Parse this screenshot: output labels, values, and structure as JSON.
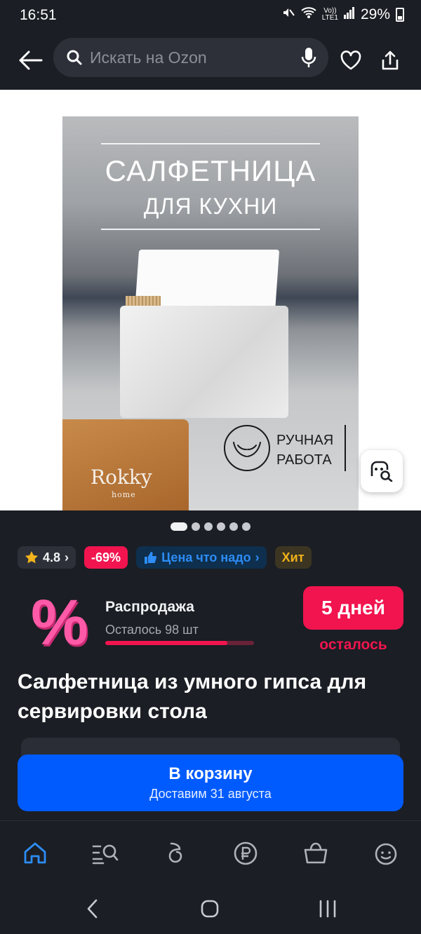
{
  "status": {
    "time": "16:51",
    "network": "LTE1",
    "volte": "Vo))",
    "battery": "29%"
  },
  "header": {
    "search_placeholder": "Искать на Ozon"
  },
  "product_image": {
    "title_line1": "САЛФЕТНИЦА",
    "title_line2": "ДЛЯ КУХНИ",
    "badge_line1": "РУЧНАЯ",
    "badge_line2": "РАБОТА",
    "brand": "Rokky",
    "brand_sub": "home"
  },
  "gallery": {
    "total": 6,
    "active": 1
  },
  "chips": {
    "rating": "4.8",
    "discount": "-69%",
    "price_label": "Цена что надо",
    "hit": "Хит"
  },
  "sale": {
    "title": "Распродажа",
    "remaining": "Осталось 98 шт",
    "progress": 0.82,
    "days_value": "5 дней",
    "days_label": "осталось"
  },
  "product": {
    "title": "Салфетница из умного гипса для сервировки стола"
  },
  "cart": {
    "label": "В корзину",
    "delivery": "Доставим 31 августа"
  },
  "colors": {
    "accent": "#005bff",
    "sale": "#f1144f",
    "bg": "#1b1e24"
  }
}
